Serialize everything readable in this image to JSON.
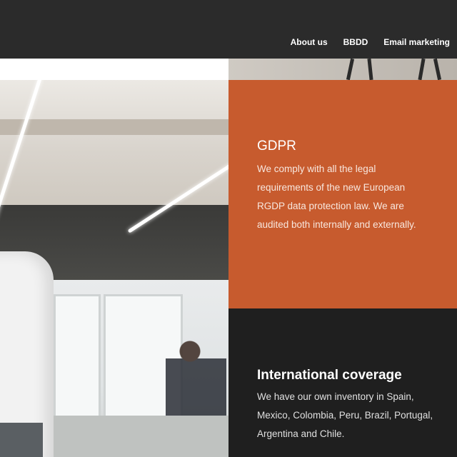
{
  "nav": {
    "items": [
      {
        "label": "About us"
      },
      {
        "label": "BBDD"
      },
      {
        "label": "Email marketing"
      }
    ]
  },
  "features": {
    "gdpr": {
      "title": "GDPR",
      "text": "We comply with all the legal requirements of the new European RGDP data protection law. We are audited both internally and externally.",
      "background": "#c75b2e"
    },
    "coverage": {
      "title": "International coverage",
      "text": "We have our own inventory in Spain, Mexico, Colombia, Peru, Brazil, Portugal, Argentina and Chile.",
      "background": "#1f1f1f"
    }
  },
  "header": {
    "background": "#2b2b2b"
  }
}
